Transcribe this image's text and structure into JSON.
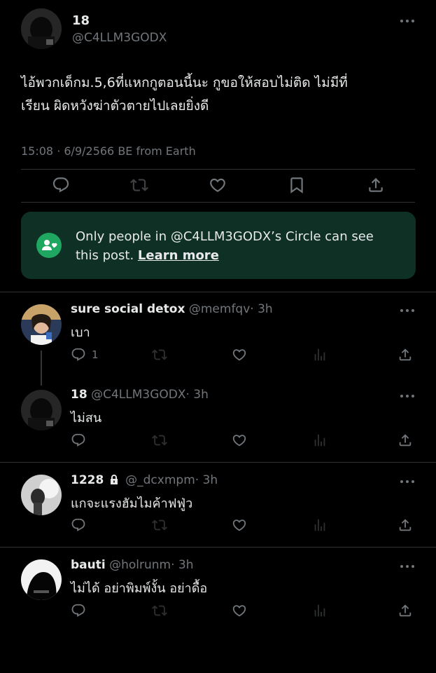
{
  "main_post": {
    "display_name": "18",
    "handle": "@C4LLM3GODX",
    "text_line1": "ไอ้พวกเด็กม.5,6ที่แหกกูตอนนี้นะ กูขอให้สอบไม่ติด ไม่มีที่",
    "text_line2": "เรียน ผิดหวังฆ่าตัวตายไปเลยยิ่งดี",
    "meta": "15:08 · 6/9/2566 BE from Earth",
    "actions": [
      "reply-icon",
      "retweet-icon",
      "like-icon",
      "bookmark-icon",
      "share-icon"
    ]
  },
  "circle_notice": {
    "text_line1": "Only people in @C4LLM3GODX’s Circle can see",
    "text_line2": "this post.",
    "link": "Learn more",
    "accent": "#1b7f4f",
    "background": "#0f3025"
  },
  "replies": [
    {
      "display_name": "sure social detox",
      "handle": "@memfqv",
      "time": "· 3h",
      "text": "เบา",
      "reply_count": "1",
      "lock": false
    },
    {
      "display_name": "18",
      "handle": "@C4LLM3GODX",
      "time": "· 3h",
      "text": "ไม่สน",
      "reply_count": "",
      "lock": false
    },
    {
      "display_name": "1228",
      "handle": "@_dcxmpm",
      "time": "· 3h",
      "text": "แกจะแรงฮัมไมค้าฟฟู่ว",
      "reply_count": "",
      "lock": true
    },
    {
      "display_name": "bauti",
      "handle": "@holrunm",
      "time": "· 3h",
      "text": "ไม่ได้ อย่าพิมพ์งั้น อย่าดื้อ",
      "reply_count": "",
      "lock": false
    }
  ],
  "colors": {
    "background": "#000000",
    "text": "#e7e9ea",
    "muted": "#71767b",
    "divider": "#2f3336"
  }
}
